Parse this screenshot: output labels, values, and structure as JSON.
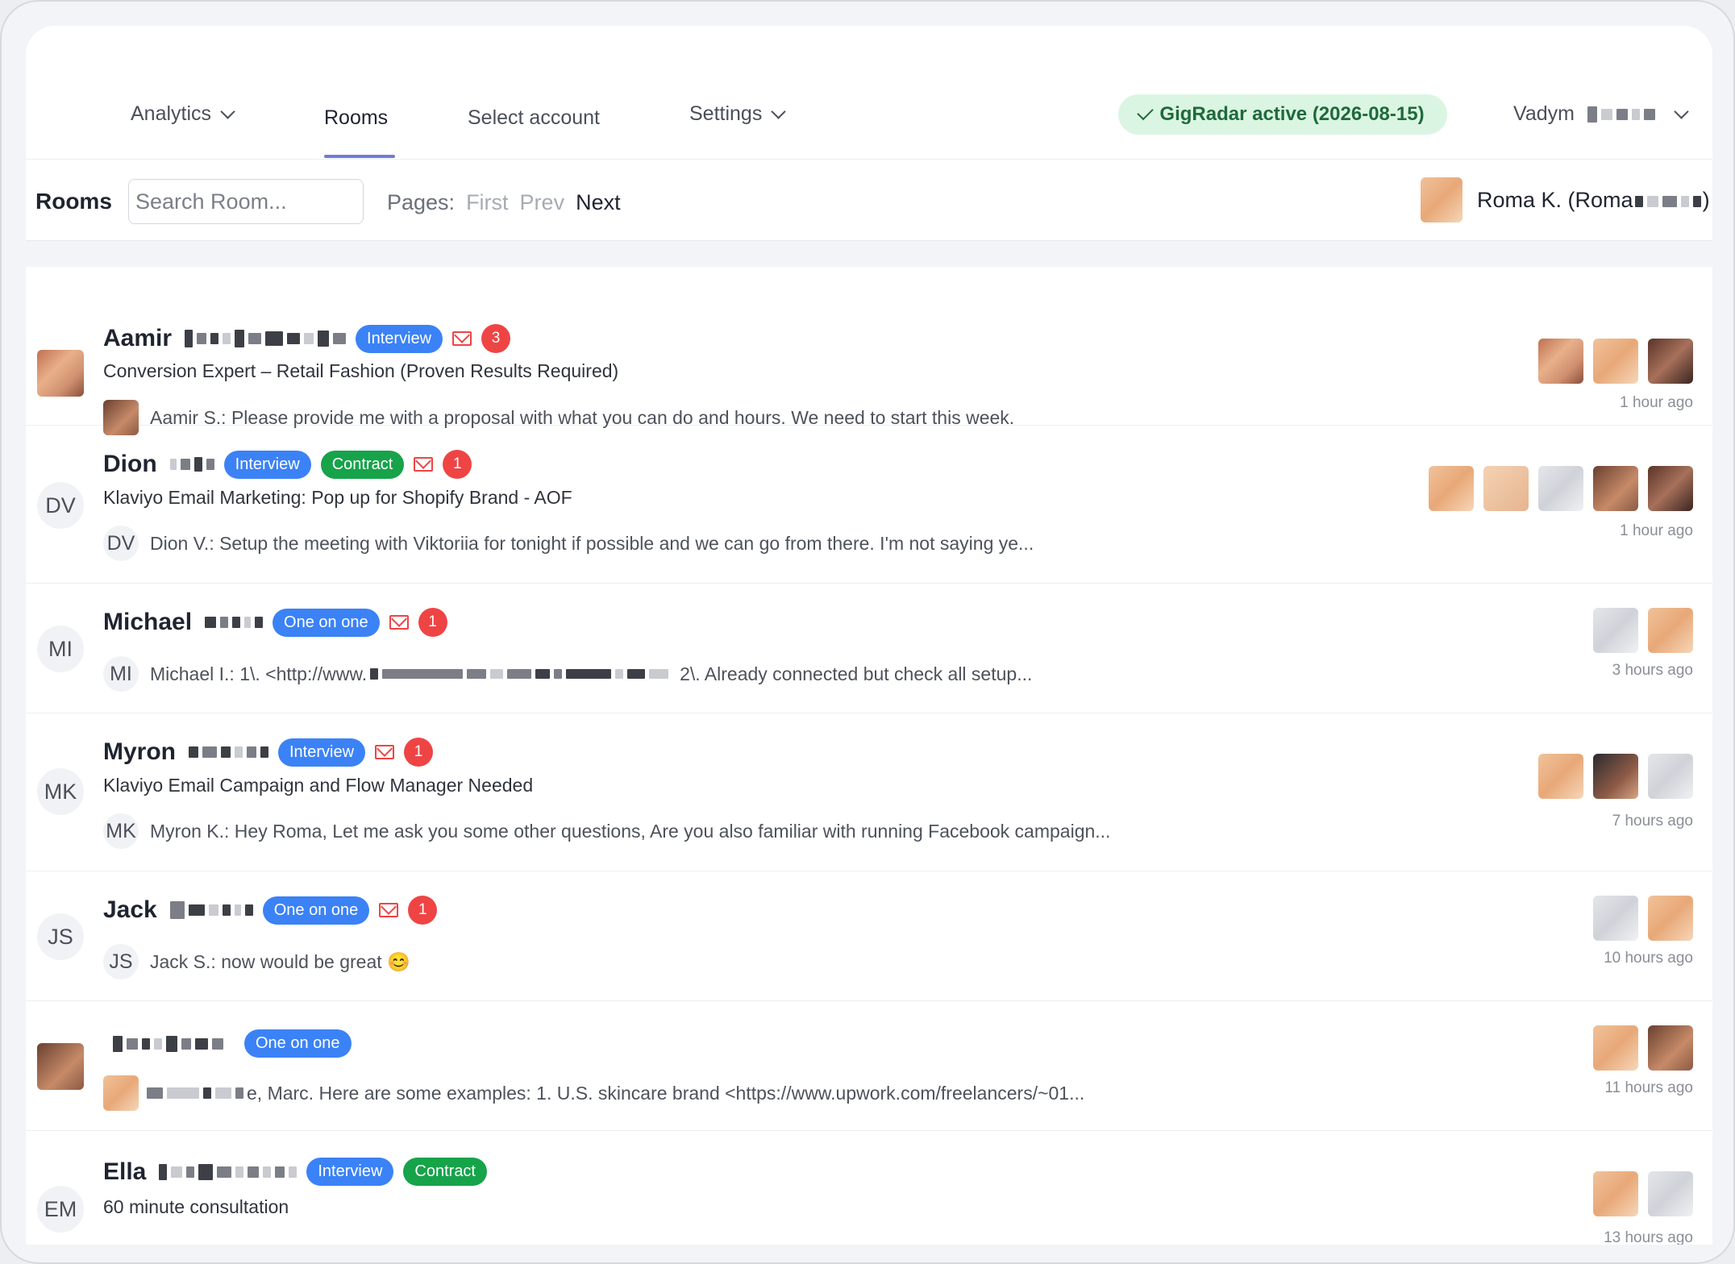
{
  "nav": {
    "analytics": "Analytics",
    "rooms": "Rooms",
    "select_account": "Select account",
    "settings": "Settings",
    "status_badge": "GigRadar active (2026-08-15)",
    "user_name": "Vadym"
  },
  "toolbar": {
    "title": "Rooms",
    "search_placeholder": "Search Room...",
    "pages_label": "Pages:",
    "first": "First",
    "prev": "Prev",
    "next": "Next",
    "account_name": "Roma K. (Roma",
    "account_suffix": ")"
  },
  "rows": [
    {
      "name": "Aamir",
      "initials": "",
      "tags": [
        "Interview"
      ],
      "unread": "3",
      "subtitle": "Conversion Expert – Retail Fashion (Proven Results Required)",
      "message": "Aamir S.: Please provide me with a proposal with what you can do and hours. We need to start this week.",
      "time": "1 hour ago"
    },
    {
      "name": "Dion",
      "initials": "DV",
      "tags": [
        "Interview",
        "Contract"
      ],
      "unread": "1",
      "subtitle": "Klaviyo Email Marketing: Pop up for Shopify Brand - AOF",
      "message": "Dion V.: Setup the meeting with Viktoriia for tonight if possible and we can go from there. I'm not saying ye...",
      "time": "1 hour ago"
    },
    {
      "name": "Michael",
      "initials": "MI",
      "tags": [
        "One on one"
      ],
      "unread": "1",
      "subtitle": "",
      "message_start": "Michael I.: 1\\. <http://www.",
      "message_end": "2\\. Already connected but check all setup...",
      "time": "3 hours ago"
    },
    {
      "name": "Myron",
      "initials": "MK",
      "tags": [
        "Interview"
      ],
      "unread": "1",
      "subtitle": "Klaviyo Email Campaign and Flow Manager Needed",
      "message": "Myron K.: Hey Roma, Let me ask you some other questions, Are you also familiar with running Facebook campaign...",
      "time": "7 hours ago"
    },
    {
      "name": "Jack",
      "initials": "JS",
      "tags": [
        "One on one"
      ],
      "unread": "1",
      "subtitle": "",
      "message": "Jack S.: now would be great 😊",
      "time": "10 hours ago"
    },
    {
      "name": "",
      "initials": "",
      "tags": [
        "One on one"
      ],
      "unread": "",
      "subtitle": "",
      "message": "e, Marc. Here are some examples: 1. U.S. skincare brand <https://www.upwork.com/freelancers/~01...",
      "time": "11 hours ago"
    },
    {
      "name": "Ella",
      "initials": "EM",
      "tags": [
        "Interview",
        "Contract"
      ],
      "unread": "",
      "subtitle": "60 minute consultation",
      "message": "",
      "time": "13 hours ago"
    }
  ],
  "colors": {
    "accent": "#6d7dd8",
    "tag_blue": "#3b82f6",
    "tag_green": "#16a34a",
    "badge_red": "#ef4444",
    "status_bg": "#dbf5e3"
  }
}
